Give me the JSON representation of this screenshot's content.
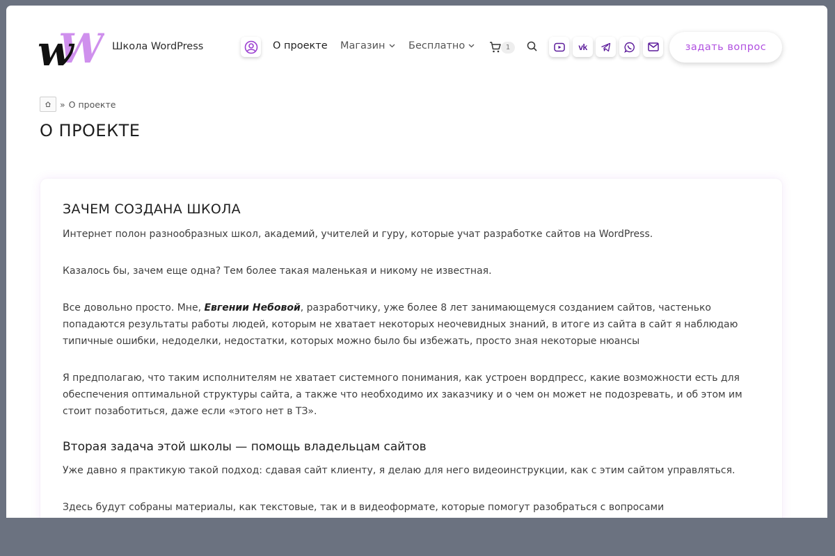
{
  "header": {
    "site_name": "Школа WordPress",
    "nav": [
      {
        "label": "О проекте",
        "active": true
      },
      {
        "label": "Магазин",
        "dropdown": true
      },
      {
        "label": "Бесплатно",
        "dropdown": true
      }
    ],
    "cart_count": "1",
    "social_icons": [
      "youtube-icon",
      "vk-icon",
      "telegram-icon",
      "whatsapp-icon",
      "mail-icon"
    ],
    "ask_button": "задать вопрос"
  },
  "breadcrumb": {
    "separator": "»",
    "current": "О проекте"
  },
  "page_title": "О ПРОЕКТЕ",
  "content": {
    "heading": "ЗАЧЕМ СОЗДАНА ШКОЛА",
    "p1": "Интернет полон разнообразных школ, академий, учителей и гуру, которые учат разработке сайтов на WordPress.",
    "p2": "Казалось бы, зачем еще одна? Тем более такая маленькая и никому не известная.",
    "p3_before": "Все довольно просто. Мне, ",
    "p3_bold": "Евгении Небовой",
    "p3_after": ", разработчику, уже более 8 лет занимающемуся созданием сайтов, частенько попадаются результаты работы людей, которым не хватает некоторых неочевидных знаний, в итоге из сайта в сайт я наблюдаю типичные ошибки, недоделки, недостатки, которых можно было бы избежать, просто зная некоторые нюансы",
    "p4": "Я предполагаю, что таким исполнителям не хватает системного понимания, как устроен вордпресс, какие возможности есть для обеспечения оптимальной структуры сайта, а также что необходимо их заказчику и о чем он может не подозревать, и об этом им стоит позаботиться, даже если «этого нет в ТЗ».",
    "subheading": "Вторая задача этой школы — помощь владельцам сайтов",
    "p5": "Уже давно я практикую такой подход: сдавая сайт клиенту, я делаю для него видеоинструкции, как с этим сайтом управляться.",
    "p6": "Здесь будут собраны материалы, как текстовые, так и в видеоформате, которые помогут разобраться с вопросами"
  },
  "colors": {
    "accent": "#b04fe0",
    "logo_purple": "#c77dea",
    "vk_purple": "#5b1a9a",
    "frame": "#6b7280"
  }
}
